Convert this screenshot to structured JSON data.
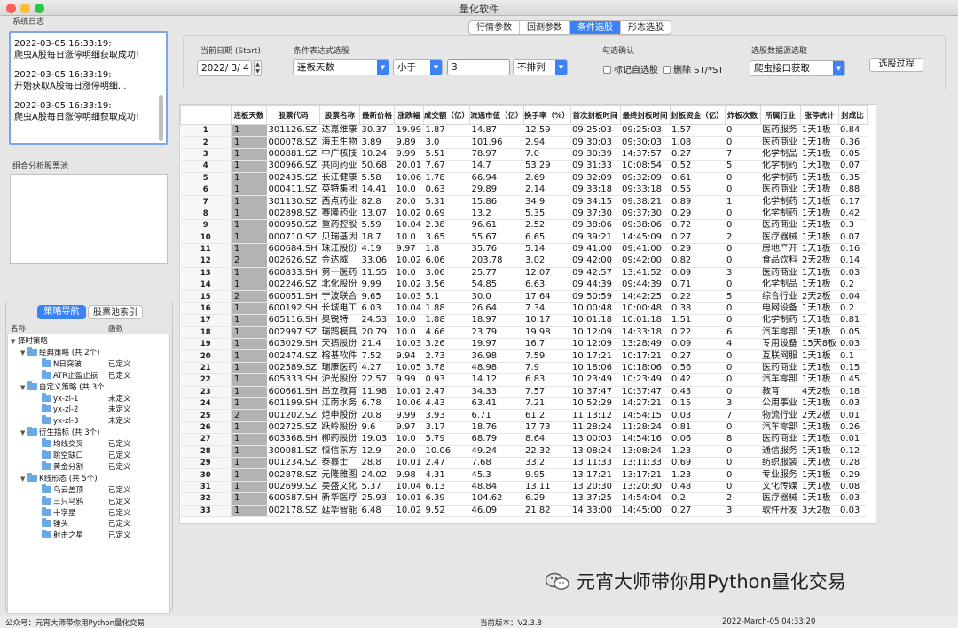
{
  "window": {
    "title": "量化软件"
  },
  "system_log": {
    "title": "系统日志",
    "entries": [
      {
        "time": "2022-03-05 16:33:19:",
        "msg": "爬虫A股每日涨停明细获取成功!"
      },
      {
        "time": "2022-03-05 16:33:19:",
        "msg": "开始获取A股每日涨停明细..."
      },
      {
        "time": "2022-03-05 16:33:19:",
        "msg": "爬虫A股每日涨停明细获取成功!"
      }
    ]
  },
  "stock_pool": {
    "title": "组合分析股票池"
  },
  "nav": {
    "seg_active": "策略导航",
    "seg_other": "股票池索引",
    "col_name": "名称",
    "col_func": "函数",
    "root": "择时策略",
    "groups": [
      {
        "label": "经典策略 (共 2个)",
        "items": [
          {
            "name": "N日突破",
            "func": "已定义"
          },
          {
            "name": "ATR止盈止损",
            "func": "已定义"
          }
        ]
      },
      {
        "label": "自定义策略 (共 3个",
        "items": [
          {
            "name": "yx-zl-1",
            "func": "未定义"
          },
          {
            "name": "yx-zl-2",
            "func": "未定义"
          },
          {
            "name": "yx-zl-3",
            "func": "未定义"
          }
        ]
      },
      {
        "label": "衍生指标 (共 3个)",
        "items": [
          {
            "name": "均线交叉",
            "func": "已定义"
          },
          {
            "name": "跳空缺口",
            "func": "已定义"
          },
          {
            "name": "黄金分割",
            "func": "已定义"
          }
        ]
      },
      {
        "label": "K线形态 (共 5个)",
        "items": [
          {
            "name": "乌云盖顶",
            "func": "已定义"
          },
          {
            "name": "三只乌鸦",
            "func": "已定义"
          },
          {
            "name": "十字星",
            "func": "已定义"
          },
          {
            "name": "锤头",
            "func": "已定义"
          },
          {
            "name": "射击之星",
            "func": "已定义"
          }
        ]
      }
    ]
  },
  "tabs": [
    {
      "label": "行情参数",
      "active": false
    },
    {
      "label": "回测参数",
      "active": false
    },
    {
      "label": "条件选股",
      "active": true
    },
    {
      "label": "形态选股",
      "active": false
    }
  ],
  "controls": {
    "date_label": "当前日期 (Start)",
    "date_value": "2022/ 3/ 4",
    "cond_label": "条件表达式选股",
    "cond_field": "连板天数",
    "cond_op": "小于",
    "cond_value": "3",
    "cond_sort": "不排列",
    "check_label": "勾选确认",
    "chk_mark": "标记自选股",
    "chk_remove_st": "删除 ST/*ST",
    "source_label": "选股数据源选取",
    "source_value": "爬虫接口获取",
    "process_btn": "选股过程"
  },
  "table": {
    "columns": [
      "连板天数",
      "股票代码",
      "股票名称",
      "最新价格",
      "涨跌幅",
      "成交额（亿）",
      "流通市值（亿）",
      "换手率（%）",
      "首次封板时间",
      "最终封板时间",
      "封板资金（亿）",
      "炸板次数",
      "所属行业",
      "涨停统计",
      "封成比"
    ],
    "rows": [
      [
        "1",
        "301126.SZ",
        "达嘉维康",
        "30.37",
        "19.99",
        "1.87",
        "14.87",
        "12.59",
        "09:25:03",
        "09:25:03",
        "1.57",
        "0",
        "医药服务",
        "1天1板",
        "0.84"
      ],
      [
        "1",
        "000078.SZ",
        "海王生物",
        "3.89",
        "9.89",
        "3.0",
        "101.96",
        "2.94",
        "09:30:03",
        "09:30:03",
        "1.08",
        "0",
        "医药商业",
        "1天1板",
        "0.36"
      ],
      [
        "1",
        "000881.SZ",
        "中广核技",
        "10.24",
        "9.99",
        "5.51",
        "78.97",
        "7.0",
        "09:30:39",
        "14:37:57",
        "0.27",
        "7",
        "化学制品",
        "1天1板",
        "0.05"
      ],
      [
        "1",
        "300966.SZ",
        "共同药业",
        "50.68",
        "20.01",
        "7.67",
        "14.7",
        "53.29",
        "09:31:33",
        "10:08:54",
        "0.52",
        "5",
        "化学制药",
        "1天1板",
        "0.07"
      ],
      [
        "1",
        "002435.SZ",
        "长江健康",
        "5.58",
        "10.06",
        "1.78",
        "66.94",
        "2.69",
        "09:32:09",
        "09:32:09",
        "0.61",
        "0",
        "化学制药",
        "1天1板",
        "0.35"
      ],
      [
        "1",
        "000411.SZ",
        "英特集团",
        "14.41",
        "10.0",
        "0.63",
        "29.89",
        "2.14",
        "09:33:18",
        "09:33:18",
        "0.55",
        "0",
        "医药商业",
        "1天1板",
        "0.88"
      ],
      [
        "1",
        "301130.SZ",
        "西点药业",
        "82.8",
        "20.0",
        "5.31",
        "15.86",
        "34.9",
        "09:34:15",
        "09:38:21",
        "0.89",
        "1",
        "化学制药",
        "1天1板",
        "0.17"
      ],
      [
        "1",
        "002898.SZ",
        "赛隆药业",
        "13.07",
        "10.02",
        "0.69",
        "13.2",
        "5.35",
        "09:37:30",
        "09:37:30",
        "0.29",
        "0",
        "化学制药",
        "1天1板",
        "0.42"
      ],
      [
        "1",
        "000950.SZ",
        "重药控股",
        "5.59",
        "10.04",
        "2.38",
        "96.61",
        "2.52",
        "09:38:06",
        "09:38:06",
        "0.72",
        "0",
        "医药商业",
        "1天1板",
        "0.3"
      ],
      [
        "1",
        "000710.SZ",
        "贝瑞基因",
        "18.7",
        "10.0",
        "3.65",
        "55.67",
        "6.65",
        "09:39:21",
        "14:45:09",
        "0.27",
        "2",
        "医疗器械",
        "1天1板",
        "0.07"
      ],
      [
        "1",
        "600684.SH",
        "珠江股份",
        "4.19",
        "9.97",
        "1.8",
        "35.76",
        "5.14",
        "09:41:00",
        "09:41:00",
        "0.29",
        "0",
        "房地产开",
        "1天1板",
        "0.16"
      ],
      [
        "2",
        "002626.SZ",
        "金达威",
        "33.06",
        "10.02",
        "6.06",
        "203.78",
        "3.02",
        "09:42:00",
        "09:42:00",
        "0.82",
        "0",
        "食品饮料",
        "2天2板",
        "0.14"
      ],
      [
        "1",
        "600833.SH",
        "第一医药",
        "11.55",
        "10.0",
        "3.06",
        "25.77",
        "12.07",
        "09:42:57",
        "13:41:52",
        "0.09",
        "3",
        "医药商业",
        "1天1板",
        "0.03"
      ],
      [
        "1",
        "002246.SZ",
        "北化股份",
        "9.99",
        "10.02",
        "3.56",
        "54.85",
        "6.63",
        "09:44:39",
        "09:44:39",
        "0.71",
        "0",
        "化学制品",
        "1天1板",
        "0.2"
      ],
      [
        "2",
        "600051.SH",
        "宁波联合",
        "9.65",
        "10.03",
        "5.1",
        "30.0",
        "17.64",
        "09:50:59",
        "14:42:25",
        "0.22",
        "5",
        "综合行业",
        "2天2板",
        "0.04"
      ],
      [
        "1",
        "600192.SH",
        "长城电工",
        "6.03",
        "10.04",
        "1.88",
        "26.64",
        "7.34",
        "10:00:48",
        "10:00:48",
        "0.38",
        "0",
        "电网设备",
        "1天1板",
        "0.2"
      ],
      [
        "1",
        "605116.SH",
        "奥锐特",
        "24.53",
        "10.0",
        "1.88",
        "18.97",
        "10.17",
        "10:01:18",
        "10:01:18",
        "1.51",
        "0",
        "化学制药",
        "1天1板",
        "0.81"
      ],
      [
        "1",
        "002997.SZ",
        "瑞鹄模具",
        "20.79",
        "10.0",
        "4.66",
        "23.79",
        "19.98",
        "10:12:09",
        "14:33:18",
        "0.22",
        "6",
        "汽车零部",
        "1天1板",
        "0.05"
      ],
      [
        "1",
        "603029.SH",
        "天鹅股份",
        "21.4",
        "10.03",
        "3.26",
        "19.97",
        "16.7",
        "10:12:09",
        "13:28:49",
        "0.09",
        "4",
        "专用设备",
        "15天8板",
        "0.03"
      ],
      [
        "1",
        "002474.SZ",
        "榕基软件",
        "7.52",
        "9.94",
        "2.73",
        "36.98",
        "7.59",
        "10:17:21",
        "10:17:21",
        "0.27",
        "0",
        "互联网服",
        "1天1板",
        "0.1"
      ],
      [
        "1",
        "002589.SZ",
        "瑞康医药",
        "4.27",
        "10.05",
        "3.78",
        "48.98",
        "7.9",
        "10:18:06",
        "10:18:06",
        "0.56",
        "0",
        "医药商业",
        "1天1板",
        "0.15"
      ],
      [
        "1",
        "605333.SH",
        "沪光股份",
        "22.57",
        "9.99",
        "0.93",
        "14.12",
        "6.83",
        "10:23:49",
        "10:23:49",
        "0.42",
        "0",
        "汽车零部",
        "1天1板",
        "0.45"
      ],
      [
        "1",
        "600661.SH",
        "昂立教育",
        "11.98",
        "10.01",
        "2.47",
        "34.33",
        "7.57",
        "10:37:47",
        "10:37:47",
        "0.43",
        "0",
        "教育",
        "4天2板",
        "0.18"
      ],
      [
        "1",
        "601199.SH",
        "江南水务",
        "6.78",
        "10.06",
        "4.43",
        "63.41",
        "7.21",
        "10:52:29",
        "14:27:21",
        "0.15",
        "3",
        "公用事业",
        "1天1板",
        "0.03"
      ],
      [
        "2",
        "001202.SZ",
        "炬申股份",
        "20.8",
        "9.99",
        "3.93",
        "6.71",
        "61.2",
        "11:13:12",
        "14:54:15",
        "0.03",
        "7",
        "物流行业",
        "2天2板",
        "0.01"
      ],
      [
        "1",
        "002725.SZ",
        "跃岭股份",
        "9.6",
        "9.97",
        "3.17",
        "18.76",
        "17.73",
        "11:28:24",
        "11:28:24",
        "0.81",
        "0",
        "汽车零部",
        "1天1板",
        "0.26"
      ],
      [
        "1",
        "603368.SH",
        "柳药股份",
        "19.03",
        "10.0",
        "5.79",
        "68.79",
        "8.64",
        "13:00:03",
        "14:54:16",
        "0.06",
        "8",
        "医药商业",
        "1天1板",
        "0.01"
      ],
      [
        "1",
        "300081.SZ",
        "恒信东方",
        "12.9",
        "20.0",
        "10.06",
        "49.24",
        "22.32",
        "13:08:24",
        "13:08:24",
        "1.23",
        "0",
        "通信服务",
        "1天1板",
        "0.12"
      ],
      [
        "1",
        "001234.SZ",
        "泰慕士",
        "28.8",
        "10.01",
        "2.47",
        "7.68",
        "33.2",
        "13:11:33",
        "13:11:33",
        "0.69",
        "0",
        "纺织服装",
        "1天1板",
        "0.28"
      ],
      [
        "1",
        "002878.SZ",
        "元隆雅图",
        "24.02",
        "9.98",
        "4.31",
        "45.3",
        "9.95",
        "13:17:21",
        "13:17:21",
        "1.23",
        "0",
        "专业服务",
        "1天1板",
        "0.29"
      ],
      [
        "1",
        "002699.SZ",
        "美盛文化",
        "5.37",
        "10.04",
        "6.13",
        "48.84",
        "13.11",
        "13:20:30",
        "13:20:30",
        "0.48",
        "0",
        "文化传媒",
        "1天1板",
        "0.08"
      ],
      [
        "1",
        "600587.SH",
        "新华医疗",
        "25.93",
        "10.01",
        "6.39",
        "104.62",
        "6.29",
        "13:37:25",
        "14:54:04",
        "0.2",
        "2",
        "医疗器械",
        "1天1板",
        "0.03"
      ],
      [
        "1",
        "002178.SZ",
        "延华智能",
        "6.48",
        "10.02",
        "9.52",
        "46.09",
        "21.82",
        "14:33:00",
        "14:45:00",
        "0.27",
        "3",
        "软件开发",
        "3天2板",
        "0.03"
      ]
    ]
  },
  "status": {
    "left": "公众号：元宵大师带你用Python量化交易",
    "center": "当前版本：V2.3.8",
    "right": "2022-March-05 04:33:20"
  },
  "watermark": "元宵大师带你用Python量化交易",
  "colors": {
    "accent": "#3b82f6",
    "close": "#fd5f57",
    "minimize": "#febc2e",
    "zoom": "#28c840"
  }
}
